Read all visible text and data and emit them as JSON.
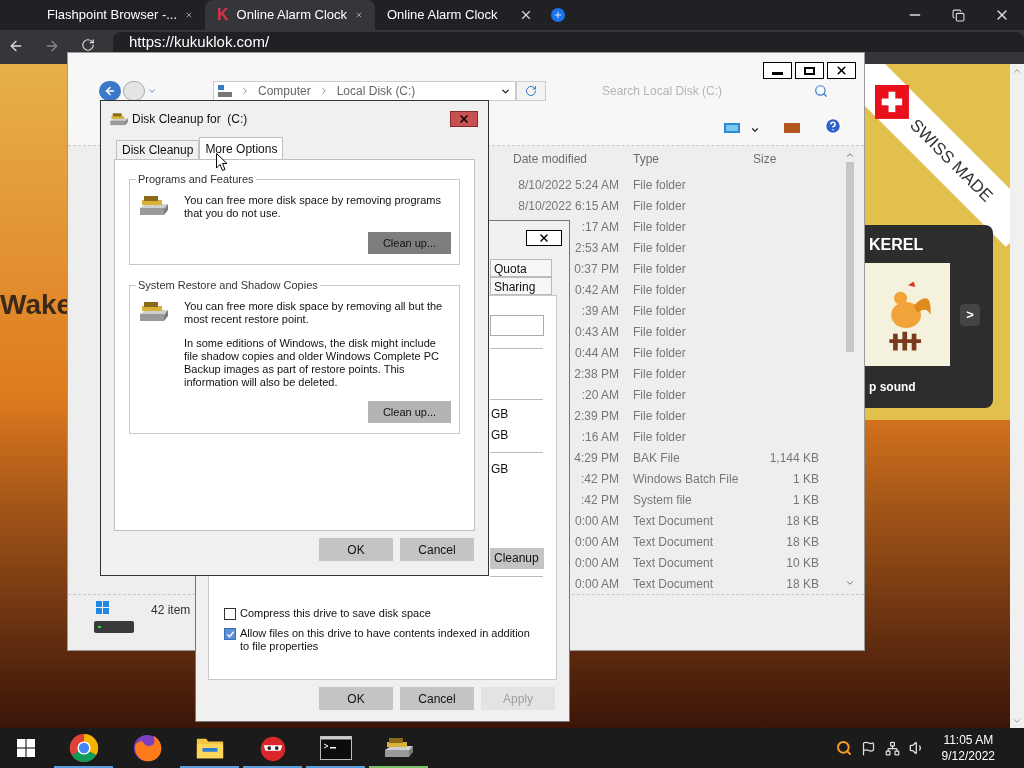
{
  "browser": {
    "tabs": [
      {
        "title": "Flashpoint Browser -...",
        "selected": false
      },
      {
        "title": "Online Alarm Clock",
        "selected": true,
        "logo": "K"
      },
      {
        "title": "Online Alarm Clock",
        "selected": false
      }
    ],
    "address": "https://kukuklok.com/"
  },
  "page": {
    "headline": "Wake",
    "ribbon": "SWISS MADE",
    "card_title": "KEREL",
    "card_caption": "p sound",
    "next_button": ">"
  },
  "explorer": {
    "breadcrumb": [
      "Computer",
      "Local Disk (C:)"
    ],
    "search_placeholder": "Search Local Disk (C:)",
    "columns": [
      "Date modified",
      "Type",
      "Size"
    ],
    "rows": [
      {
        "date": "8/10/2022 5:24 AM",
        "type": "File folder"
      },
      {
        "date": "8/10/2022 6:15 AM",
        "type": "File folder"
      },
      {
        "date": ":17 AM",
        "type": "File folder"
      },
      {
        "date": "2:53 AM",
        "type": "File folder"
      },
      {
        "date": "0:37 PM",
        "type": "File folder"
      },
      {
        "date": "0:42 AM",
        "type": "File folder"
      },
      {
        "date": ":39 AM",
        "type": "File folder"
      },
      {
        "date": "0:43 AM",
        "type": "File folder"
      },
      {
        "date": "0:44 AM",
        "type": "File folder"
      },
      {
        "date": "2:38 PM",
        "type": "File folder"
      },
      {
        "date": ":20 AM",
        "type": "File folder"
      },
      {
        "date": "2:39 PM",
        "type": "File folder"
      },
      {
        "date": ":16 AM",
        "type": "File folder"
      },
      {
        "date": "4:29 PM",
        "type": "BAK File",
        "size": "1,144 KB"
      },
      {
        "date": ":42 PM",
        "type": "Windows Batch File",
        "size": "1 KB"
      },
      {
        "date": ":42 PM",
        "type": "System file",
        "size": "1 KB"
      },
      {
        "date": "0:00 AM",
        "type": "Text Document",
        "size": "18 KB"
      },
      {
        "date": "0:00 AM",
        "type": "Text Document",
        "size": "18 KB"
      },
      {
        "date": "0:00 AM",
        "type": "Text Document",
        "size": "10 KB"
      },
      {
        "date": "0:00 AM",
        "type": "Text Document",
        "size": "18 KB"
      }
    ],
    "status": "42 item"
  },
  "properties": {
    "tabs": [
      "Quota",
      "Sharing"
    ],
    "capacity": [
      "GB",
      "GB",
      "GB"
    ],
    "cleanup_button": "Cleanup",
    "options": [
      {
        "label": "Compress this drive to save disk space",
        "checked": false
      },
      {
        "label": "Allow files on this drive to have contents indexed in addition to file properties",
        "checked": true
      }
    ],
    "buttons": [
      {
        "label": "OK",
        "disabled": false
      },
      {
        "label": "Cancel",
        "disabled": false
      },
      {
        "label": "Apply",
        "disabled": true
      }
    ]
  },
  "disk_cleanup": {
    "title": "Disk Cleanup for  (C:)",
    "tabs": [
      {
        "label": "Disk Cleanup",
        "selected": false
      },
      {
        "label": "More Options",
        "selected": true
      }
    ],
    "groups": [
      {
        "legend": "Programs and Features",
        "paragraphs": [
          "You can free more disk space by removing programs that you do not use."
        ],
        "button": {
          "label": "Clean up...",
          "focused": true
        }
      },
      {
        "legend": "System Restore and Shadow Copies",
        "paragraphs": [
          "You can free more disk space by removing all but the most recent restore point.",
          "In some editions of Windows, the disk might include file shadow copies and older Windows Complete PC Backup images as part of restore points. This information will also be deleted."
        ],
        "button": {
          "label": "Clean up...",
          "focused": false
        }
      }
    ],
    "buttons": [
      "OK",
      "Cancel"
    ]
  },
  "taskbar": {
    "apps": [
      {
        "kind": "chrome",
        "color": "#5aa0e0"
      },
      {
        "kind": "firefox"
      },
      {
        "kind": "folder",
        "color": "#5aa0e0"
      },
      {
        "kind": "flash",
        "color": "#5aa0e0"
      },
      {
        "kind": "terminal",
        "color": "#5aa0e0"
      },
      {
        "kind": "cleanup",
        "color": "#7cc26a"
      }
    ],
    "time": "11:05 AM",
    "date": "9/12/2022"
  }
}
